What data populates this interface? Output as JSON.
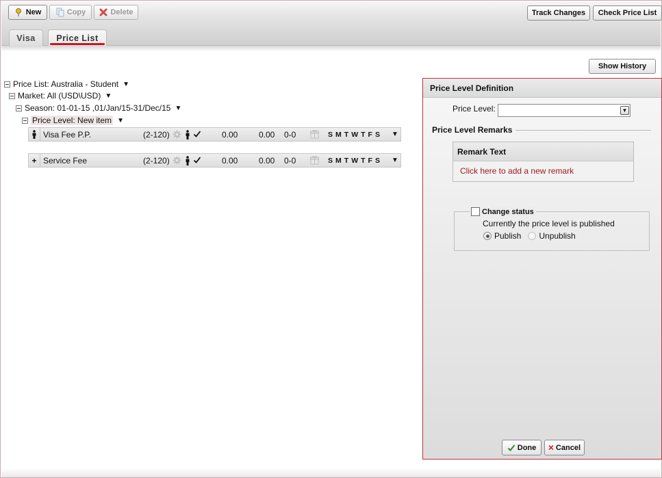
{
  "toolbar": {
    "new_label": "New",
    "copy_label": "Copy",
    "delete_label": "Delete",
    "track_changes_label": "Track Changes",
    "check_price_list_label": "Check Price List"
  },
  "tabs": [
    {
      "label": "Visa",
      "active": false
    },
    {
      "label": "Price List",
      "active": true
    }
  ],
  "show_history_label": "Show History",
  "tree": {
    "price_list": "Price List: Australia - Student",
    "market": "Market: All (USD\\USD)",
    "season": "Season: 01-01-15 ,01/Jan/15-31/Dec/15",
    "price_level_prefix": "Price Level:",
    "price_level_name": "New item"
  },
  "fees": [
    {
      "lead_icon": "person-icon",
      "lead_text": "",
      "name": "Visa Fee P.P.",
      "range": "(2-120)",
      "value1": "0.00",
      "value2": "0.00",
      "range2": "0-0",
      "days": [
        "S",
        "M",
        "T",
        "W",
        "T",
        "F",
        "S"
      ]
    },
    {
      "lead_icon": "",
      "lead_text": "+",
      "name": "Service Fee",
      "range": "(2-120)",
      "value1": "0.00",
      "value2": "0.00",
      "range2": "0-0",
      "days": [
        "S",
        "M",
        "T",
        "W",
        "T",
        "F",
        "S"
      ]
    }
  ],
  "panel": {
    "title": "Price Level Definition",
    "price_level_label": "Price Level:",
    "price_level_value": "",
    "remarks_title": "Price Level Remarks",
    "remark_header": "Remark Text",
    "remark_link": "Click here to add a new remark",
    "status_legend": "Change status",
    "status_text": "Currently the price level is published",
    "publish_label": "Publish",
    "unpublish_label": "Unpublish",
    "selected_status": "Publish",
    "done_label": "Done",
    "cancel_label": "Cancel"
  },
  "colors": {
    "accent_red": "#c8161d",
    "panel_border": "#c2303b",
    "link_red": "#9b1a22",
    "done_check": "#2e8b2e"
  }
}
